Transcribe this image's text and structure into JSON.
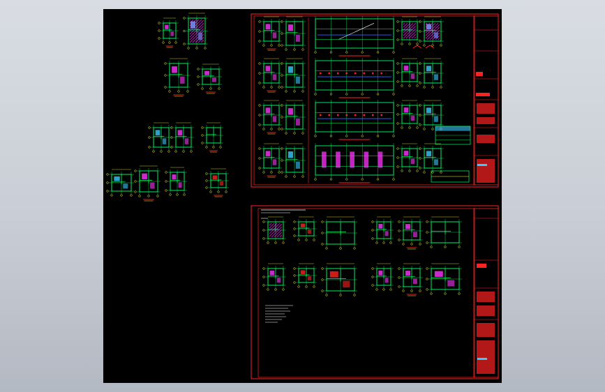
{
  "viewport": {
    "background": "#000000",
    "surround": "#cfd3da"
  },
  "colors": {
    "frame": "#ff2222",
    "walls": "#00ff66",
    "fill_magenta": "#ff33ff",
    "fill_cyan": "#33ccff",
    "dim_yellow": "#ffff33",
    "label_red": "#ff2222",
    "white": "#ffffff",
    "blue": "#3366ff"
  },
  "sheets": [
    {
      "id": "sheet-upper",
      "title_block": true
    },
    {
      "id": "sheet-lower",
      "title_block": true
    }
  ]
}
